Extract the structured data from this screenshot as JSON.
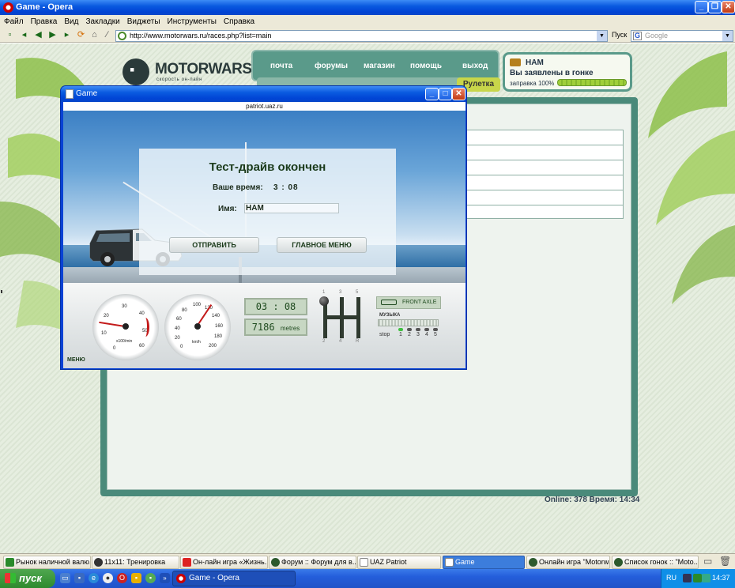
{
  "browser": {
    "title": "Game - Opera",
    "menu": [
      "Файл",
      "Правка",
      "Вид",
      "Закладки",
      "Виджеты",
      "Инструменты",
      "Справка"
    ],
    "address": "http://www.motorwars.ru/races.php?list=main",
    "go_label": "Пуск",
    "search_placeholder": "Google"
  },
  "site": {
    "logo": "MOTORWARS.RU",
    "logo_sub": "скорость он-лайн",
    "nav": [
      "почта",
      "форумы",
      "магазин",
      "помощь",
      "выход"
    ],
    "subnav_active": "Рулетка",
    "user": {
      "name": "НАМ",
      "status": "Вы заявлены в гонке",
      "fuel_label": "заправка 100%",
      "fuel_level": 1.0
    },
    "online_text": "Online: 378  Время: 14:34"
  },
  "game": {
    "window_title": "Game",
    "domain": "patriot.uaz.ru",
    "dialog": {
      "title": "Тест-драйв окончен",
      "time_label": "Ваше время:",
      "time_value": "3 : 08",
      "name_label": "Имя:",
      "name_value": "НАМ",
      "submit_label": "ОТПРАВИТЬ",
      "main_menu_label": "ГЛАВНОЕ МЕНЮ"
    },
    "dash": {
      "menu_label": "МЕНЮ",
      "tacho": {
        "labels": [
          "0",
          "10",
          "20",
          "30",
          "40",
          "50",
          "60"
        ],
        "unit": "x100/min",
        "value": 12
      },
      "speedo": {
        "labels": [
          "0",
          "20",
          "40",
          "60",
          "80",
          "100",
          "120",
          "140",
          "160",
          "180",
          "200"
        ],
        "unit": "km/h",
        "value": 125
      },
      "timer": "03 : 08",
      "distance": "7186",
      "distance_unit": "metres",
      "gear_top": [
        "1",
        "3",
        "5"
      ],
      "gear_bottom": [
        "2",
        "4",
        "R"
      ],
      "axle_label": "FRONT AXLE",
      "music_label": "МУЗЫКА",
      "music_stop": "stop",
      "music_tracks": [
        "1",
        "2",
        "3",
        "4",
        "5"
      ]
    }
  },
  "taskbar": {
    "group_tasks": [
      "Рынок наличной валю...",
      "11x11: Тренировка",
      "Он-лайн игра «Жизнь...",
      "Форум :: Форум для в...",
      "UAZ Patriot",
      "Game",
      "Онлайн игра \"Motorwa...",
      "Список гонок :: \"Moto..."
    ],
    "active_task": "Game",
    "start_label": "пуск",
    "window_task": "Game - Opera",
    "lang": "RU",
    "clock": "14:37"
  }
}
